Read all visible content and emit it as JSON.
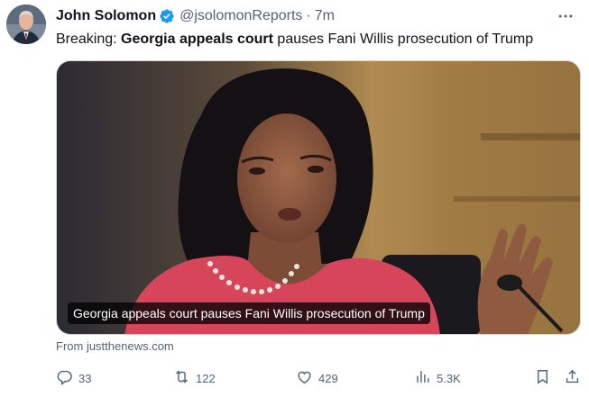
{
  "tweet": {
    "author_name": "John Solomon",
    "verified_icon": "verified-badge-icon",
    "handle": "@jsolomonReports",
    "separator": "·",
    "time": "7m",
    "more_icon": "more-icon",
    "text_prefix": "Breaking: ",
    "text_bold": "Georgia appeals court",
    "text_suffix": " pauses Fani Willis prosecution of Trump"
  },
  "media": {
    "caption": "Georgia appeals court pauses Fani Willis prosecution of Trump"
  },
  "source": "From justthenews.com",
  "actions": {
    "reply": {
      "icon": "reply-icon",
      "count": "33"
    },
    "repost": {
      "icon": "repost-icon",
      "count": "122"
    },
    "like": {
      "icon": "like-icon",
      "count": "429"
    },
    "views": {
      "icon": "views-icon",
      "count": "5.3K"
    },
    "bookmark": {
      "icon": "bookmark-icon"
    },
    "share": {
      "icon": "share-icon"
    }
  },
  "colors": {
    "accent": "#1d9bf0",
    "muted": "#536471",
    "text": "#0f1419",
    "border": "#cfd9de"
  }
}
